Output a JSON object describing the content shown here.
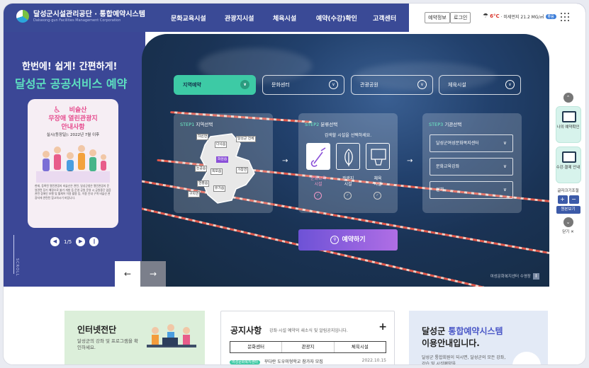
{
  "header": {
    "logo_title": "달성군시설관리공단 · 통합예약시스템",
    "logo_sub": "Dalseong-gun Facilities Management Corporation",
    "nav": [
      "문화교육시설",
      "관광지시설",
      "체육시설",
      "예약(수강)확인",
      "고객센터"
    ],
    "btn_reservation": "예약정보",
    "btn_login": "로그인",
    "weather_temp": "6°C",
    "weather_dust": "· 미세먼지 21.2 MG/㎥",
    "weather_badge": "좋음"
  },
  "left": {
    "slogan1": "한번에! 쉽게! 간편하게!",
    "slogan2": "달성군 공공서비스 예약",
    "card_line1": "비슬산",
    "card_line2": "무장애 열린관광지",
    "card_line3": "안내사항",
    "card_date": "실시(등장일): 2022년 7월 이후",
    "card_body": "현재, 등록된 열린관광지 비슬산은 관련, 달성군청은 열린관광지 운영관련 장기 예정으로 불가 개발 등 운영 공원 운영 시 공원중단 없음 관련 장애인 보행 및 휠체어 이용 활용 등, 이용 안내 구역 비슬산 관광지에 관련된 참고하시기 바랍니다.",
    "pager": "1/5",
    "scroll_label": "SCROLL"
  },
  "hero": {
    "tabs": [
      {
        "label": "지역예약",
        "active": true
      },
      {
        "label": "문화센터",
        "active": false
      },
      {
        "label": "관광공원",
        "active": false
      },
      {
        "label": "체육시설",
        "active": false
      }
    ],
    "step1_num": "STEP1",
    "step1_label": "지역선택",
    "step2_num": "STEP2",
    "step2_label": "분류선택",
    "step2_hint": "검색할 시설을 선택하세요.",
    "step3_num": "STEP3",
    "step3_label": "기관선택",
    "regions": [
      "하빈면",
      "다사읍",
      "달성군 전체",
      "화원읍",
      "논공읍",
      "옥포읍",
      "가창면",
      "현풍읍",
      "유가읍",
      "구지면"
    ],
    "categories": [
      {
        "line1": "문화교육",
        "line2": "시설",
        "active": true
      },
      {
        "line1": "관광지",
        "line2": "시설",
        "active": false
      },
      {
        "line1": "체육",
        "line2": "시설",
        "active": false
      }
    ],
    "selects": [
      "달성군여성문화복지센터",
      "문화교육강좌",
      "전체"
    ],
    "reserve_label": "예약하기",
    "caption": "여성문화복지센터 수영장"
  },
  "quick": {
    "item1": "나의 예약확인",
    "item2": "수강·결제 안내",
    "font_title": "글자크기조절",
    "font_reset": "원본보기",
    "close": "닫기"
  },
  "bottom": {
    "card1_title": "인터넷전단",
    "card1_sub": "달성군의 강좌 및 프로그램을 확인하세요.",
    "notice_title": "공지사항",
    "notice_sub": "강좌·시설 예약의 새소식 및 알림공지입니다.",
    "notice_tabs": [
      "문화센터",
      "관광지",
      "체육시설"
    ],
    "notice_row_tag": "여성문화복지센터",
    "notice_row_text": "꾸다란 도우미형학교 참가자 모집",
    "notice_row_date": "2022.10.15",
    "card3_title_em": "통합예약시스템",
    "card3_title_pre": "달성군 ",
    "card3_title2": "이용안내입니다.",
    "card3_sub": "달성군 통합회원이 되시면, 달성군의 모든 강좌, 강습 및 시설예약을"
  },
  "colors": {
    "header": "#3a4a96",
    "accent_green": "#3dcaa5",
    "accent_purple": "#8a4fd8"
  }
}
